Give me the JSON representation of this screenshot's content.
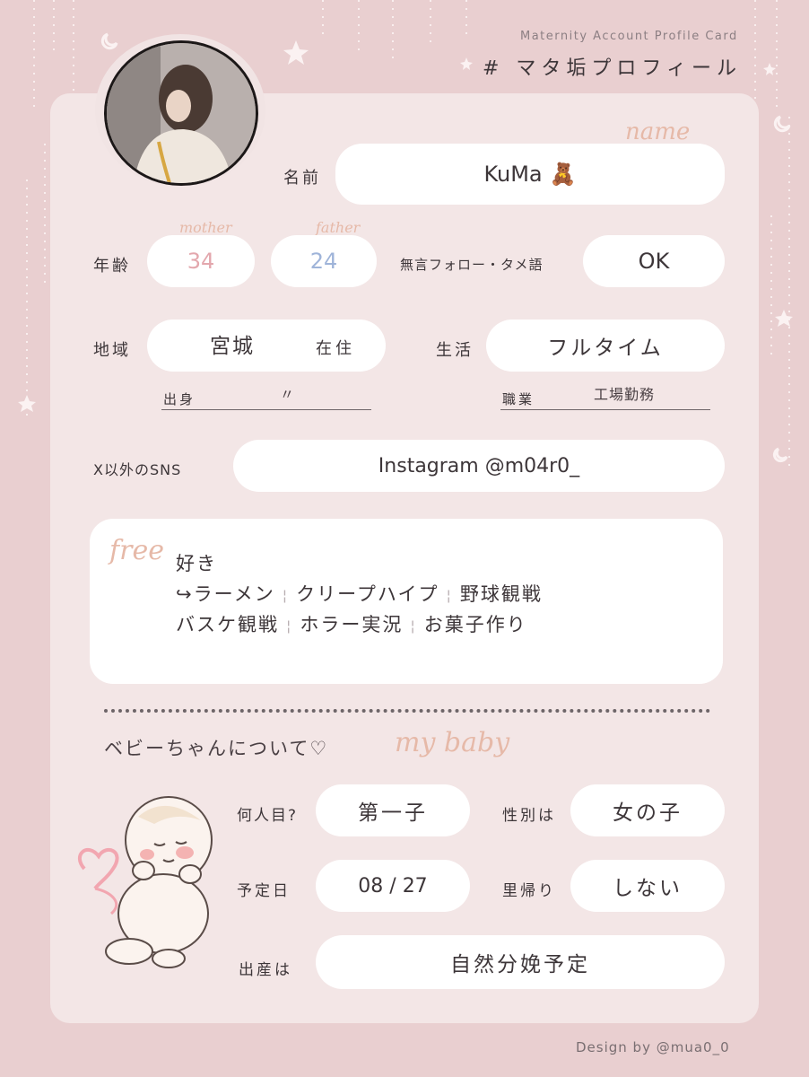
{
  "header": {
    "subtitle": "Maternity Account Profile Card",
    "title": "# マタ垢プロフィール"
  },
  "profile": {
    "name_label": "名前",
    "name_script": "name",
    "name_value": "KuMa",
    "name_emoji": "🧸",
    "age_label": "年齢",
    "mother_script": "mother",
    "mother_age": "34",
    "father_script": "father",
    "father_age": "24",
    "silent_follow_label": "無言フォロー・タメ語",
    "silent_follow_value": "OK",
    "region_label": "地域",
    "region_value": "宮城",
    "region_suffix": "在住",
    "birthplace_label": "出身",
    "birthplace_value": "〃",
    "life_label": "生活",
    "life_value": "フルタイム",
    "job_label": "職業",
    "job_value": "工場勤務",
    "sns_label": "X以外のSNS",
    "sns_value": "Instagram @m04r0_"
  },
  "free": {
    "script": "free",
    "heading": "好き",
    "line1": [
      "↪ラーメン",
      "クリープハイプ",
      "野球観戦"
    ],
    "line2": [
      "バスケ観戦",
      "ホラー実況",
      "お菓子作り"
    ]
  },
  "baby": {
    "heading": "ベビーちゃんについて♡",
    "script": "my baby",
    "order_label": "何人目?",
    "order_value": "第一子",
    "gender_label": "性別は",
    "gender_value": "女の子",
    "due_label": "予定日",
    "due_value": "08 / 27",
    "return_label": "里帰り",
    "return_value": "しない",
    "birth_label": "出産は",
    "birth_value": "自然分娩予定"
  },
  "footer": {
    "credit": "Design by @mua0_0"
  },
  "colors": {
    "background": "#e9cfd0",
    "card": "#f3e6e6",
    "script_accent": "#e6b9a8",
    "mother_age": "#e3a7ad",
    "father_age": "#9fb4d9"
  }
}
